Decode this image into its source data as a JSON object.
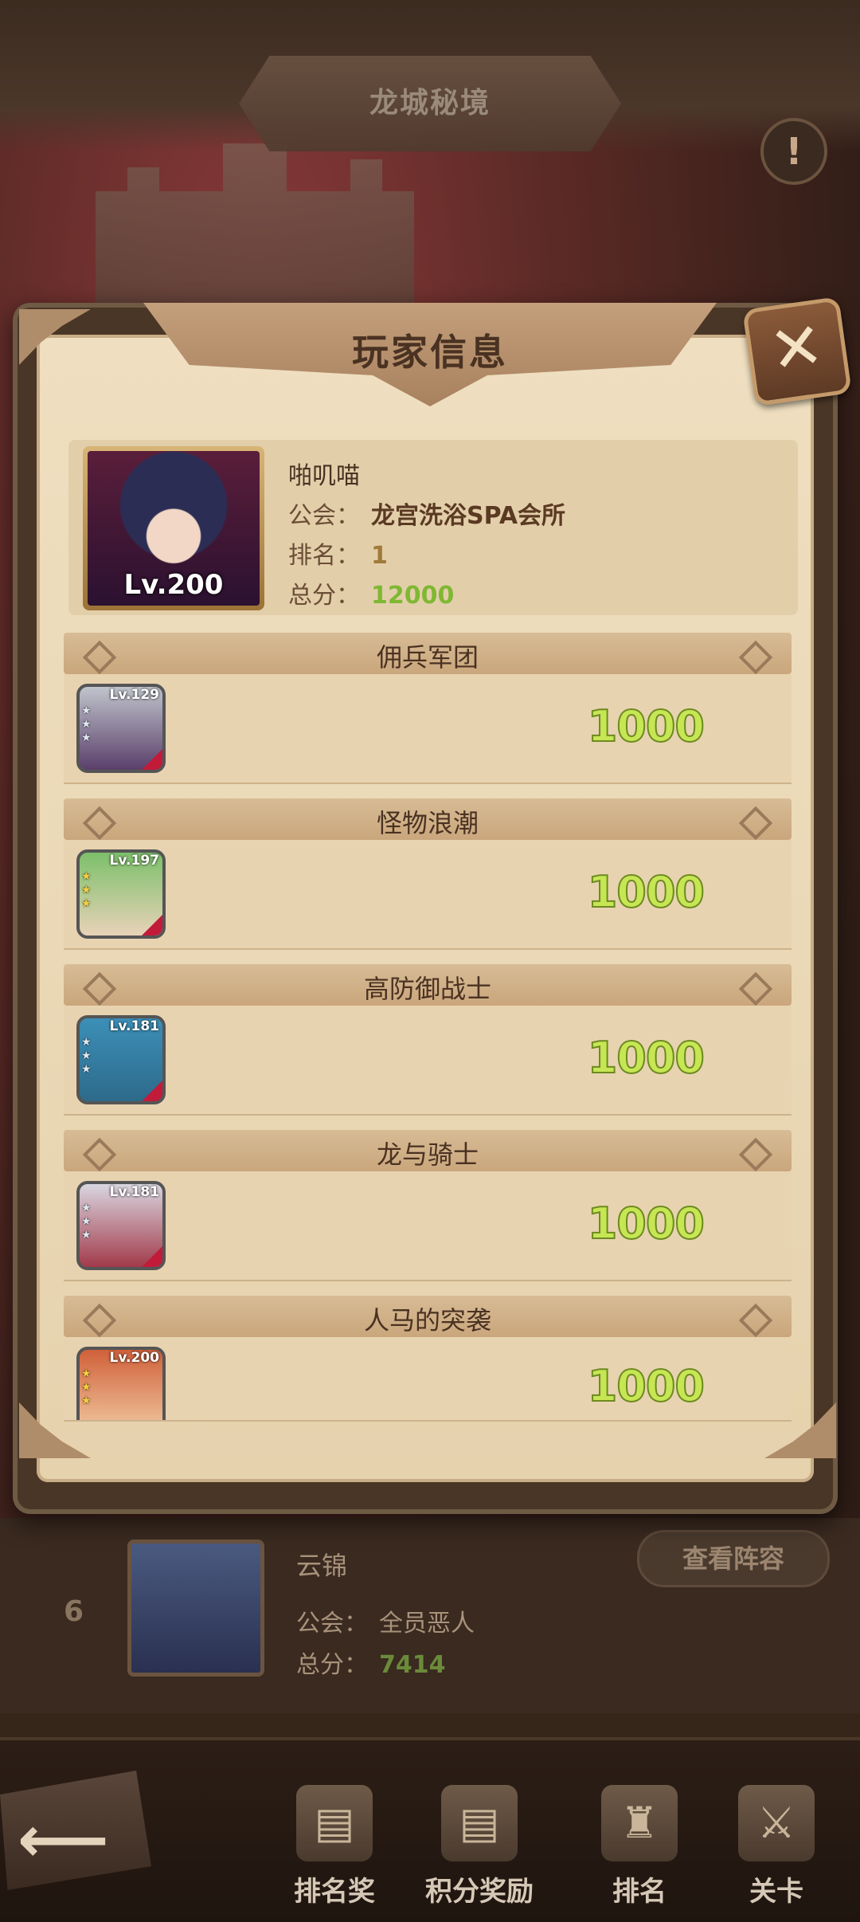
{
  "background": {
    "title": "龙城秘境",
    "alert_icon": "exclamation-icon",
    "list_row": {
      "rank": "6",
      "name": "云锦",
      "guild_label": "公会：",
      "guild": "全员恶人",
      "score_label": "总分：",
      "score": "7414",
      "view_button": "查看阵容"
    }
  },
  "modal": {
    "title": "玩家信息",
    "close_icon": "close-icon",
    "player": {
      "name": "啪叽喵",
      "level": "Lv.200",
      "guild_label": "公会：",
      "guild": "龙宫洗浴SPA会所",
      "rank_label": "排名：",
      "rank": "1",
      "score_label": "总分：",
      "score": "12000"
    },
    "sections": [
      {
        "title": "佣兵军团",
        "hero_level": "Lv.129",
        "score": "1000"
      },
      {
        "title": "怪物浪潮",
        "hero_level": "Lv.197",
        "score": "1000"
      },
      {
        "title": "高防御战士",
        "hero_level": "Lv.181",
        "score": "1000"
      },
      {
        "title": "龙与骑士",
        "hero_level": "Lv.181",
        "score": "1000"
      },
      {
        "title": "人马的突袭",
        "hero_level": "Lv.200",
        "score": "1000"
      }
    ]
  },
  "nav": {
    "back_icon": "back-arrow-icon",
    "items": [
      {
        "label": "排名奖",
        "icon": "rank-reward-icon"
      },
      {
        "label": "积分奖励",
        "icon": "points-reward-icon"
      },
      {
        "label": "排名",
        "icon": "ranking-icon"
      },
      {
        "label": "关卡",
        "icon": "stage-icon"
      }
    ]
  },
  "colors": {
    "score_green": "#c6e654",
    "panel_parchment": "#efdfc0",
    "header_brown": "#a8815e"
  }
}
